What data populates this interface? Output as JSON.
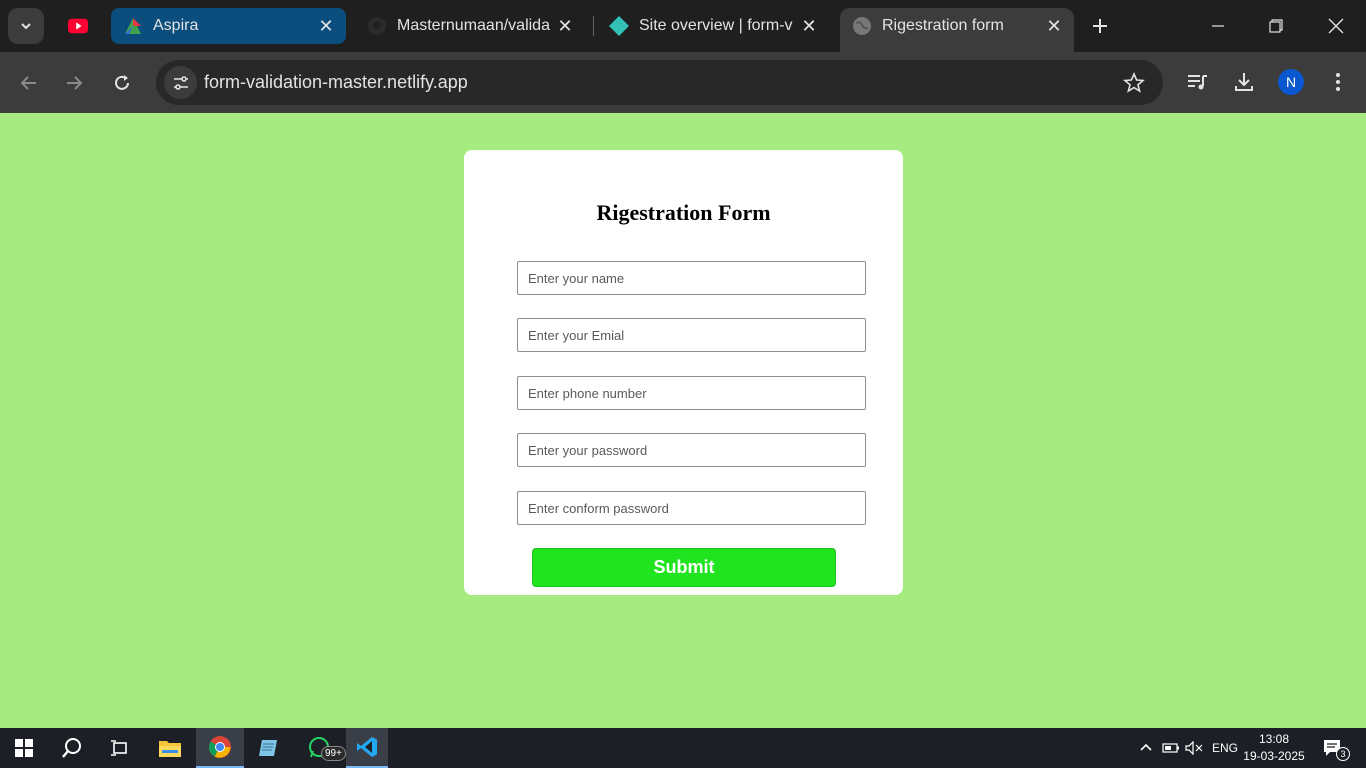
{
  "browser": {
    "tabs": [
      {
        "title": "",
        "favicon": "youtube-icon"
      },
      {
        "title": "Aspira",
        "favicon": "aspira-icon"
      },
      {
        "title": "Masternumaan/valida",
        "favicon": "github-icon"
      },
      {
        "title": "Site overview | form-v",
        "favicon": "netlify-icon"
      },
      {
        "title": "Rigestration form",
        "favicon": "globe-icon",
        "active": true
      }
    ],
    "url": "form-validation-master.netlify.app",
    "profile_initial": "N"
  },
  "form": {
    "title": "Rigestration Form",
    "fields": [
      {
        "placeholder": "Enter your name",
        "value": ""
      },
      {
        "placeholder": "Enter your Emial",
        "value": ""
      },
      {
        "placeholder": "Enter phone number",
        "value": ""
      },
      {
        "placeholder": "Enter your password",
        "value": ""
      },
      {
        "placeholder": "Enter conform password",
        "value": ""
      }
    ],
    "submit_label": "Submit"
  },
  "taskbar": {
    "whatsapp_badge": "99+",
    "language": "ENG",
    "time": "13:08",
    "date": "19-03-2025",
    "notification_count": "3"
  },
  "colors": {
    "page_background": "#a6eb80",
    "submit_button": "#20e420",
    "active_tab_aspira": "#0b4e7e"
  }
}
